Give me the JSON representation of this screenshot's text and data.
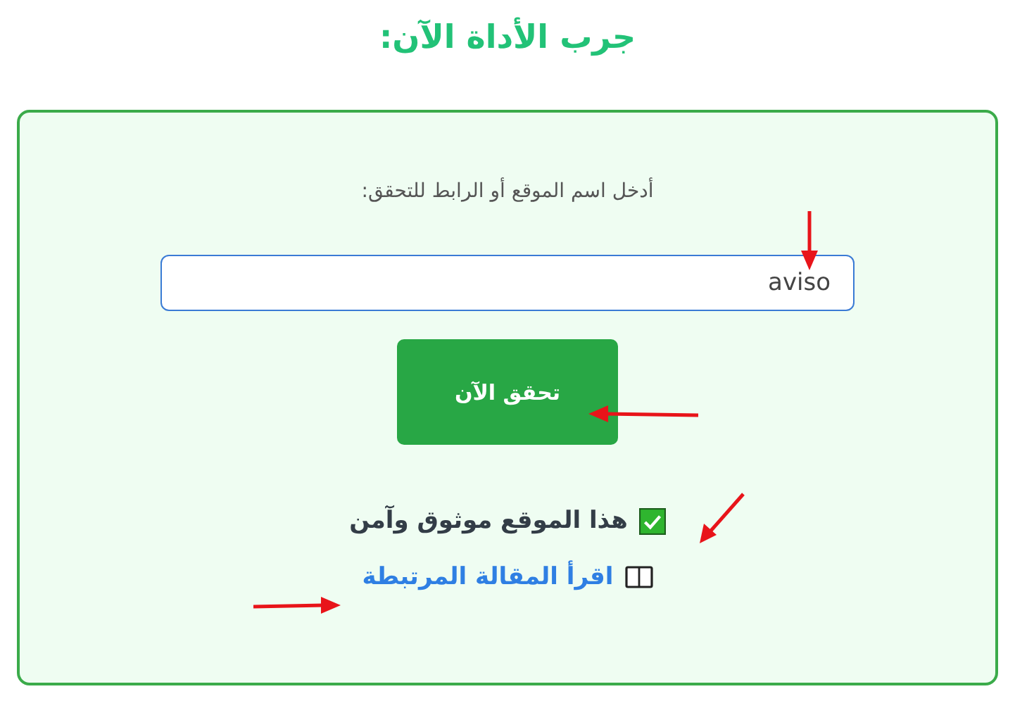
{
  "title": "جرب الأداة الآن:",
  "form": {
    "label": "أدخل اسم الموقع أو الرابط للتحقق:",
    "input": {
      "value": "aviso"
    },
    "button": "تحقق الآن"
  },
  "result": {
    "kind": "safe",
    "text": "هذا الموقع موثوق وآمن"
  },
  "link": {
    "text": "اقرأ المقالة المرتبطة"
  }
}
